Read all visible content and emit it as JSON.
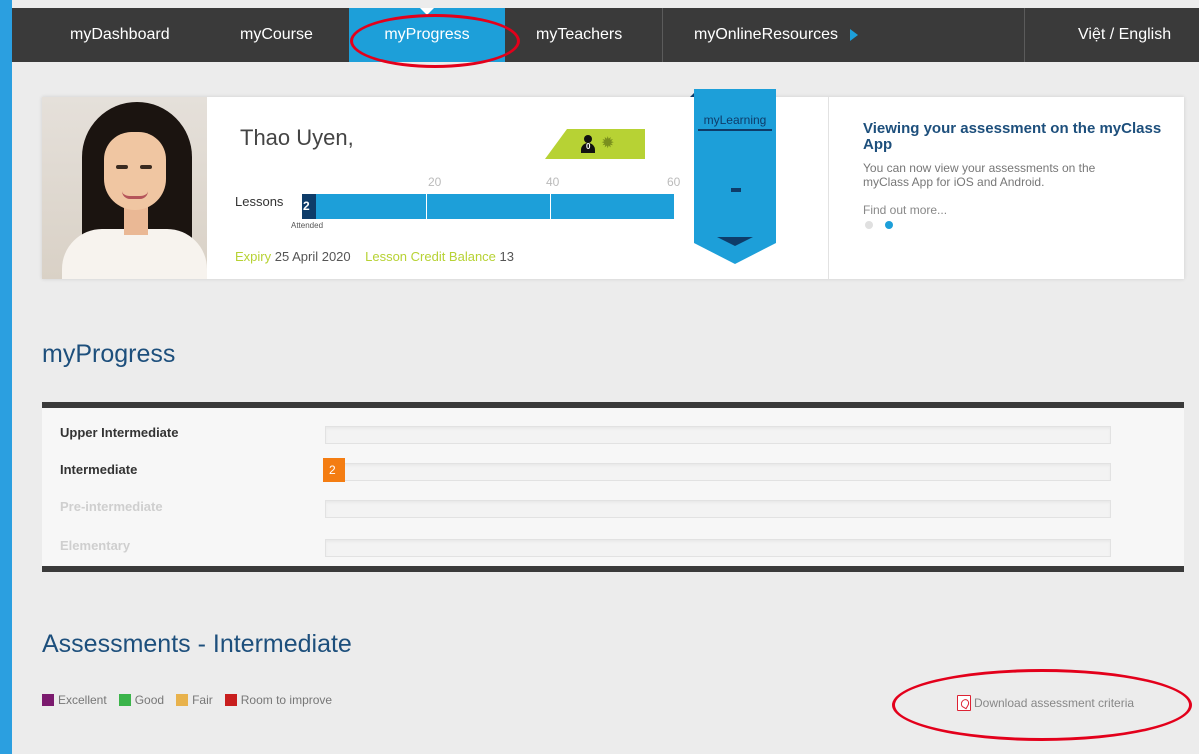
{
  "nav": {
    "items": [
      {
        "label": "myDashboard"
      },
      {
        "label": "myCourse"
      },
      {
        "label": "myProgress",
        "active": true
      },
      {
        "label": "myTeachers"
      },
      {
        "label": "myOnlineResources"
      }
    ],
    "language": "Việt / English"
  },
  "profile": {
    "name": "Thao Uyen,",
    "badge": {
      "count": "0"
    },
    "lessons": {
      "label": "Lessons",
      "attended_count": "2",
      "attended_label": "Attended",
      "scale": [
        "20",
        "40",
        "60"
      ]
    },
    "expiry_label": "Expiry",
    "expiry_date": "25 April 2020",
    "credit_label": "Lesson Credit Balance",
    "credit_value": "13"
  },
  "mylearning": {
    "title": "myLearning"
  },
  "news": {
    "headline": "Viewing your assessment on the myClass App",
    "body": "You can now view your assessments on the myClass App for iOS and Android.",
    "link": "Find out more..."
  },
  "progress": {
    "title": "myProgress",
    "levels": [
      {
        "name": "Upper Intermediate",
        "value": ""
      },
      {
        "name": "Intermediate",
        "value": "2"
      },
      {
        "name": "Pre-intermediate",
        "value": ""
      },
      {
        "name": "Elementary",
        "value": ""
      }
    ]
  },
  "assessments": {
    "title": "Assessments - Intermediate",
    "legend": [
      {
        "label": "Excellent",
        "color": "#7b1a6e"
      },
      {
        "label": "Good",
        "color": "#3bb44a"
      },
      {
        "label": "Fair",
        "color": "#e8b24c"
      },
      {
        "label": "Room to improve",
        "color": "#c81e1e"
      }
    ],
    "download_label": "Download assessment criteria"
  },
  "colors": {
    "accent": "#1d9fd9",
    "navy": "#0e3c69",
    "lime": "#b7d234",
    "orange": "#f47d12",
    "annotation": "#e3001b"
  }
}
